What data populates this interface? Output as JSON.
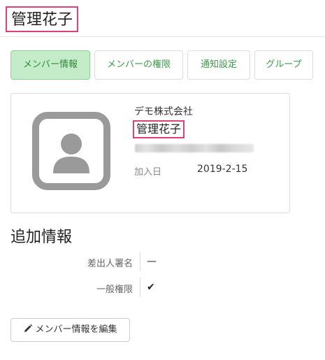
{
  "header": {
    "title": "管理花子"
  },
  "tabs": [
    {
      "label": "メンバー情報",
      "active": true
    },
    {
      "label": "メンバーの権限",
      "active": false
    },
    {
      "label": "通知設定",
      "active": false
    },
    {
      "label": "グループ",
      "active": false
    }
  ],
  "profile": {
    "company": "デモ株式会社",
    "name": "管理花子",
    "email_redacted": true,
    "joined_label": "加入日",
    "joined_value": "2019-2-15",
    "avatar_icon": "user-silhouette-icon"
  },
  "additional_info": {
    "title": "追加情報",
    "rows": [
      {
        "label": "差出人署名",
        "value": "—"
      },
      {
        "label": "一般権限",
        "value": "✔"
      }
    ]
  },
  "actions": {
    "edit_label": "メンバー情報を編集",
    "edit_icon": "pencil-icon"
  },
  "colors": {
    "highlight_border": "#e0407a",
    "tab_active_bg": "#c4ecc9",
    "tab_text": "#3c9b4a",
    "avatar_gray": "#9a9a9a"
  }
}
